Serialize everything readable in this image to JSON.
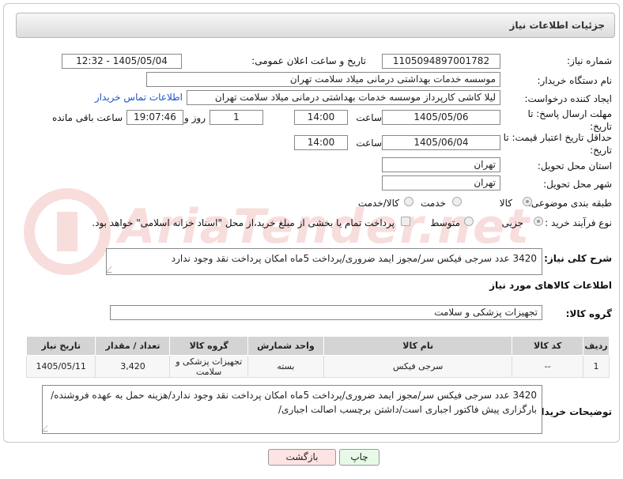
{
  "header": {
    "title": "جزئیات اطلاعات نیاز"
  },
  "form": {
    "need_number_label": "شماره نیاز:",
    "need_number": "1105094897001782",
    "announce_label": "تاریخ و ساعت اعلان عمومی:",
    "announce_value": "1405/05/04 - 12:32",
    "buyer_org_label": "نام دستگاه خریدار:",
    "buyer_org": "موسسه خدمات بهداشتی درمانی میلاد سلامت تهران",
    "requester_label": "ایجاد کننده درخواست:",
    "requester": "لیلا کاشی کارپرداز موسسه خدمات بهداشتی درمانی میلاد سلامت تهران",
    "contact_link": "اطلاعات تماس خریدار",
    "deadline_label": "مهلت ارسال پاسخ: تا تاریخ:",
    "deadline_date": "1405/05/06",
    "time_label": "ساعت",
    "deadline_time": "14:00",
    "days_value": "1",
    "days_label": "روز و",
    "remaining_time": "19:07:46",
    "remaining_label": "ساعت باقی مانده",
    "validity_label": "حداقل تاریخ اعتبار قیمت: تا تاریخ:",
    "validity_date": "1405/06/04",
    "validity_time": "14:00",
    "province_label": "استان محل تحویل:",
    "province": "تهران",
    "city_label": "شهر محل تحویل:",
    "city": "تهران",
    "category_label": "طبقه بندی موضوعی:",
    "category_options": [
      "کالا",
      "خدمت",
      "کالا/خدمت"
    ],
    "process_label": "نوع فرآیند خرید :",
    "process_options": [
      "جزیی",
      "متوسط"
    ],
    "payment_note": "پرداخت تمام یا بخشی از مبلغ خرید،از محل \"اسناد خزانه اسلامی\" خواهد بود.",
    "summary_label": "شرح کلی نیاز:",
    "summary": "3420 عدد سرجی فیکس سر/مجوز ایمد ضروری/پرداخت 5ماه امکان پرداخت نقد وجود ندارد",
    "goods_info_title": "اطلاعات کالاهای مورد نیاز",
    "goods_group_label": "گروه کالا:",
    "goods_group": "تجهیزات پزشکی و سلامت"
  },
  "table": {
    "headers": [
      "ردیف",
      "کد کالا",
      "نام کالا",
      "واحد شمارش",
      "گروه کالا",
      "تعداد / مقدار",
      "تاریخ نیاز"
    ],
    "rows": [
      [
        "1",
        "--",
        "سرجی فیکس",
        "بسته",
        "تجهیزات پزشکی و سلامت",
        "3,420",
        "1405/05/11"
      ]
    ]
  },
  "buyer_notes_label": "توضیحات خریدار:",
  "buyer_notes": "3420 عدد سرجی فیکس سر/مجوز ایمد ضروری/پرداخت 5ماه امکان پرداخت نقد وجود ندارد/هزینه حمل به عهده فروشنده/ بارگزاری پیش فاکتور اجباری است/داشتن برچسب اصالت اجباری/",
  "buttons": {
    "print": "چاپ",
    "back": "بازگشت"
  },
  "watermark": "AriaTender.net",
  "colors": {
    "link": "#1a56c8",
    "back_button": "#fde3e3",
    "print_button": "#e8f9e8",
    "header_bg": "#dcdcdc"
  }
}
